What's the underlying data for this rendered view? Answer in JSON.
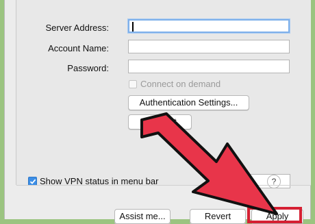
{
  "form": {
    "server_address_label": "Server Address:",
    "account_name_label": "Account Name:",
    "password_label": "Password:",
    "server_address_value": "",
    "account_name_value": "",
    "password_value": "",
    "connect_on_demand_label": "Connect on demand",
    "authentication_settings_label": "Authentication Settings...",
    "connect_label": "Connect"
  },
  "footer": {
    "show_vpn_status_label": "Show VPN status in menu bar",
    "help_label": "?",
    "assist_me_label": "Assist me...",
    "revert_label": "Revert",
    "apply_label": "Apply"
  },
  "colors": {
    "arrow_fill": "#e8354a",
    "highlight": "#d52033",
    "checkbox_accent": "#3c8ee6",
    "frame_green": "#9bc480"
  },
  "icons": [
    "help-icon",
    "check-icon",
    "pointer-arrow-icon"
  ]
}
